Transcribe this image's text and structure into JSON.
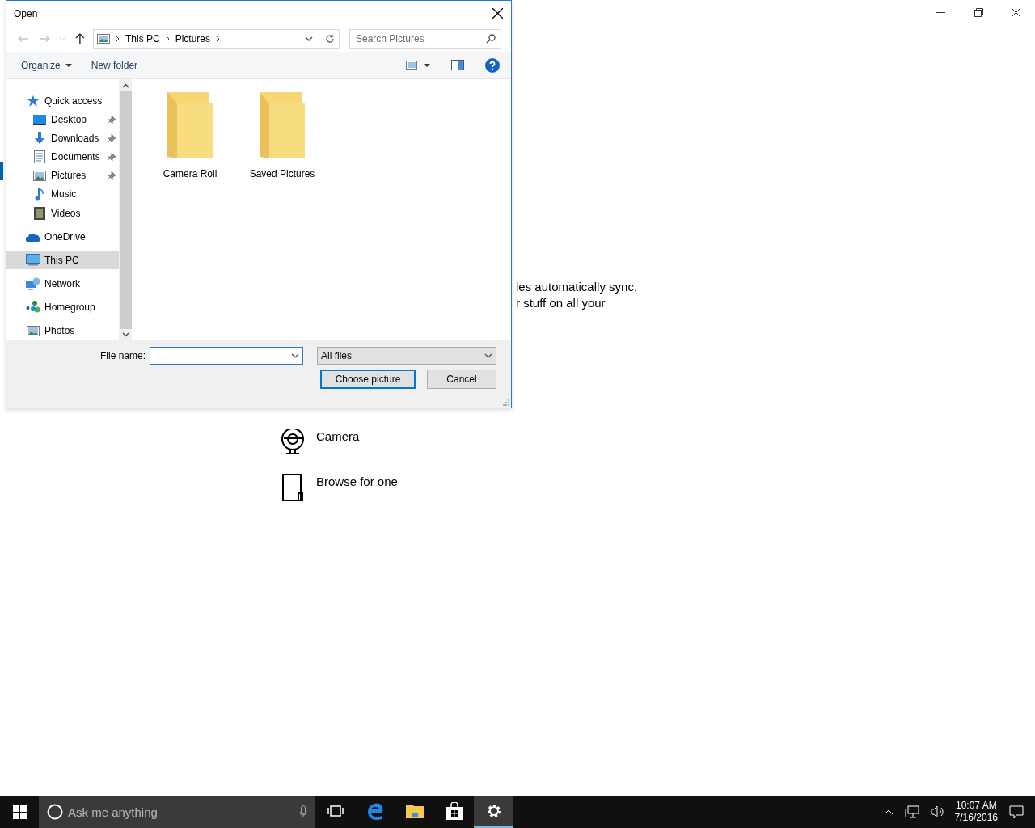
{
  "background": {
    "text_lines": [
      "les automatically sync.",
      "r stuff on all your"
    ],
    "options": [
      {
        "kind": "camera",
        "label": "Camera"
      },
      {
        "kind": "browse",
        "label": "Browse for one"
      }
    ]
  },
  "dialog": {
    "title": "Open",
    "breadcrumb": [
      "This PC",
      "Pictures"
    ],
    "search": {
      "placeholder": "Search Pictures"
    },
    "toolbar": [
      "Organize",
      "New folder"
    ],
    "nav": [
      {
        "label": "Quick access",
        "kind": "star",
        "selected": false,
        "children": [
          {
            "label": "Desktop",
            "kind": "desktop",
            "pinned": true,
            "selected": false
          },
          {
            "label": "Downloads",
            "kind": "download",
            "pinned": true,
            "selected": false
          },
          {
            "label": "Documents",
            "kind": "document",
            "pinned": true,
            "selected": false
          },
          {
            "label": "Pictures",
            "kind": "picture",
            "pinned": true,
            "selected": false
          },
          {
            "label": "Music",
            "kind": "music",
            "pinned": false,
            "selected": false
          },
          {
            "label": "Videos",
            "kind": "video",
            "pinned": false,
            "selected": false
          }
        ]
      },
      {
        "label": "OneDrive",
        "kind": "cloud",
        "selected": false
      },
      {
        "label": "This PC",
        "kind": "computer",
        "selected": true
      },
      {
        "label": "Network",
        "kind": "network",
        "selected": false
      },
      {
        "label": "Homegroup",
        "kind": "homegroup",
        "selected": false
      },
      {
        "label": "Photos",
        "kind": "picture",
        "selected": false
      }
    ],
    "folders": [
      "Camera Roll",
      "Saved Pictures"
    ],
    "file_name_label": "File name:",
    "file_type": "All files",
    "buttons": [
      {
        "label": "Choose picture",
        "default": true
      },
      {
        "label": "Cancel",
        "default": false
      }
    ]
  },
  "taskbar": {
    "search_placeholder": "Ask me anything",
    "apps": [
      {
        "kind": "task-view",
        "active": false
      },
      {
        "kind": "browser",
        "active": false
      },
      {
        "kind": "folder",
        "active": false
      },
      {
        "kind": "store",
        "active": false
      },
      {
        "kind": "settings",
        "active": true
      }
    ],
    "time": "10:07 AM",
    "date": "7/16/2016"
  }
}
